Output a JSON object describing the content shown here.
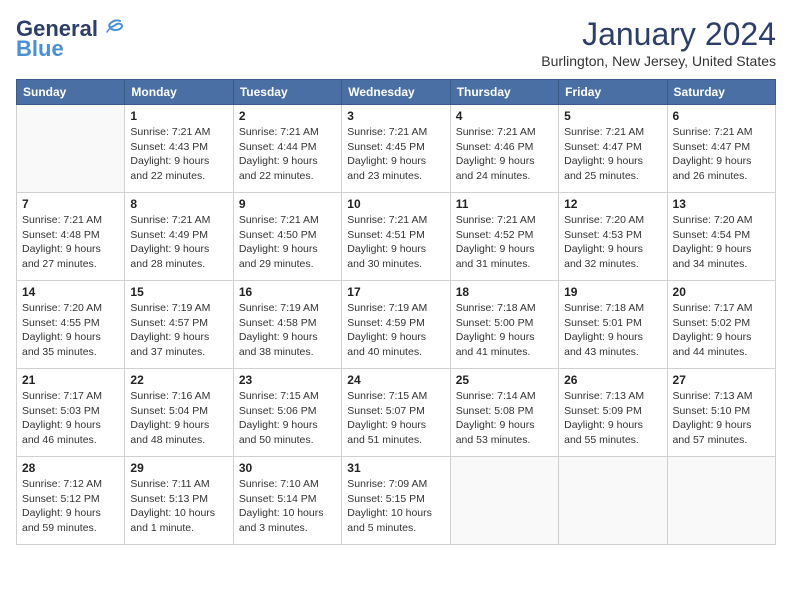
{
  "header": {
    "logo_general": "General",
    "logo_blue": "Blue",
    "month_title": "January 2024",
    "location": "Burlington, New Jersey, United States"
  },
  "weekdays": [
    "Sunday",
    "Monday",
    "Tuesday",
    "Wednesday",
    "Thursday",
    "Friday",
    "Saturday"
  ],
  "weeks": [
    [
      {
        "day": "",
        "empty": true
      },
      {
        "day": "1",
        "sunrise": "7:21 AM",
        "sunset": "4:43 PM",
        "daylight": "9 hours and 22 minutes."
      },
      {
        "day": "2",
        "sunrise": "7:21 AM",
        "sunset": "4:44 PM",
        "daylight": "9 hours and 22 minutes."
      },
      {
        "day": "3",
        "sunrise": "7:21 AM",
        "sunset": "4:45 PM",
        "daylight": "9 hours and 23 minutes."
      },
      {
        "day": "4",
        "sunrise": "7:21 AM",
        "sunset": "4:46 PM",
        "daylight": "9 hours and 24 minutes."
      },
      {
        "day": "5",
        "sunrise": "7:21 AM",
        "sunset": "4:47 PM",
        "daylight": "9 hours and 25 minutes."
      },
      {
        "day": "6",
        "sunrise": "7:21 AM",
        "sunset": "4:47 PM",
        "daylight": "9 hours and 26 minutes."
      }
    ],
    [
      {
        "day": "7",
        "sunrise": "7:21 AM",
        "sunset": "4:48 PM",
        "daylight": "9 hours and 27 minutes."
      },
      {
        "day": "8",
        "sunrise": "7:21 AM",
        "sunset": "4:49 PM",
        "daylight": "9 hours and 28 minutes."
      },
      {
        "day": "9",
        "sunrise": "7:21 AM",
        "sunset": "4:50 PM",
        "daylight": "9 hours and 29 minutes."
      },
      {
        "day": "10",
        "sunrise": "7:21 AM",
        "sunset": "4:51 PM",
        "daylight": "9 hours and 30 minutes."
      },
      {
        "day": "11",
        "sunrise": "7:21 AM",
        "sunset": "4:52 PM",
        "daylight": "9 hours and 31 minutes."
      },
      {
        "day": "12",
        "sunrise": "7:20 AM",
        "sunset": "4:53 PM",
        "daylight": "9 hours and 32 minutes."
      },
      {
        "day": "13",
        "sunrise": "7:20 AM",
        "sunset": "4:54 PM",
        "daylight": "9 hours and 34 minutes."
      }
    ],
    [
      {
        "day": "14",
        "sunrise": "7:20 AM",
        "sunset": "4:55 PM",
        "daylight": "9 hours and 35 minutes."
      },
      {
        "day": "15",
        "sunrise": "7:19 AM",
        "sunset": "4:57 PM",
        "daylight": "9 hours and 37 minutes."
      },
      {
        "day": "16",
        "sunrise": "7:19 AM",
        "sunset": "4:58 PM",
        "daylight": "9 hours and 38 minutes."
      },
      {
        "day": "17",
        "sunrise": "7:19 AM",
        "sunset": "4:59 PM",
        "daylight": "9 hours and 40 minutes."
      },
      {
        "day": "18",
        "sunrise": "7:18 AM",
        "sunset": "5:00 PM",
        "daylight": "9 hours and 41 minutes."
      },
      {
        "day": "19",
        "sunrise": "7:18 AM",
        "sunset": "5:01 PM",
        "daylight": "9 hours and 43 minutes."
      },
      {
        "day": "20",
        "sunrise": "7:17 AM",
        "sunset": "5:02 PM",
        "daylight": "9 hours and 44 minutes."
      }
    ],
    [
      {
        "day": "21",
        "sunrise": "7:17 AM",
        "sunset": "5:03 PM",
        "daylight": "9 hours and 46 minutes."
      },
      {
        "day": "22",
        "sunrise": "7:16 AM",
        "sunset": "5:04 PM",
        "daylight": "9 hours and 48 minutes."
      },
      {
        "day": "23",
        "sunrise": "7:15 AM",
        "sunset": "5:06 PM",
        "daylight": "9 hours and 50 minutes."
      },
      {
        "day": "24",
        "sunrise": "7:15 AM",
        "sunset": "5:07 PM",
        "daylight": "9 hours and 51 minutes."
      },
      {
        "day": "25",
        "sunrise": "7:14 AM",
        "sunset": "5:08 PM",
        "daylight": "9 hours and 53 minutes."
      },
      {
        "day": "26",
        "sunrise": "7:13 AM",
        "sunset": "5:09 PM",
        "daylight": "9 hours and 55 minutes."
      },
      {
        "day": "27",
        "sunrise": "7:13 AM",
        "sunset": "5:10 PM",
        "daylight": "9 hours and 57 minutes."
      }
    ],
    [
      {
        "day": "28",
        "sunrise": "7:12 AM",
        "sunset": "5:12 PM",
        "daylight": "9 hours and 59 minutes."
      },
      {
        "day": "29",
        "sunrise": "7:11 AM",
        "sunset": "5:13 PM",
        "daylight": "10 hours and 1 minute."
      },
      {
        "day": "30",
        "sunrise": "7:10 AM",
        "sunset": "5:14 PM",
        "daylight": "10 hours and 3 minutes."
      },
      {
        "day": "31",
        "sunrise": "7:09 AM",
        "sunset": "5:15 PM",
        "daylight": "10 hours and 5 minutes."
      },
      {
        "day": "",
        "empty": true
      },
      {
        "day": "",
        "empty": true
      },
      {
        "day": "",
        "empty": true
      }
    ]
  ]
}
